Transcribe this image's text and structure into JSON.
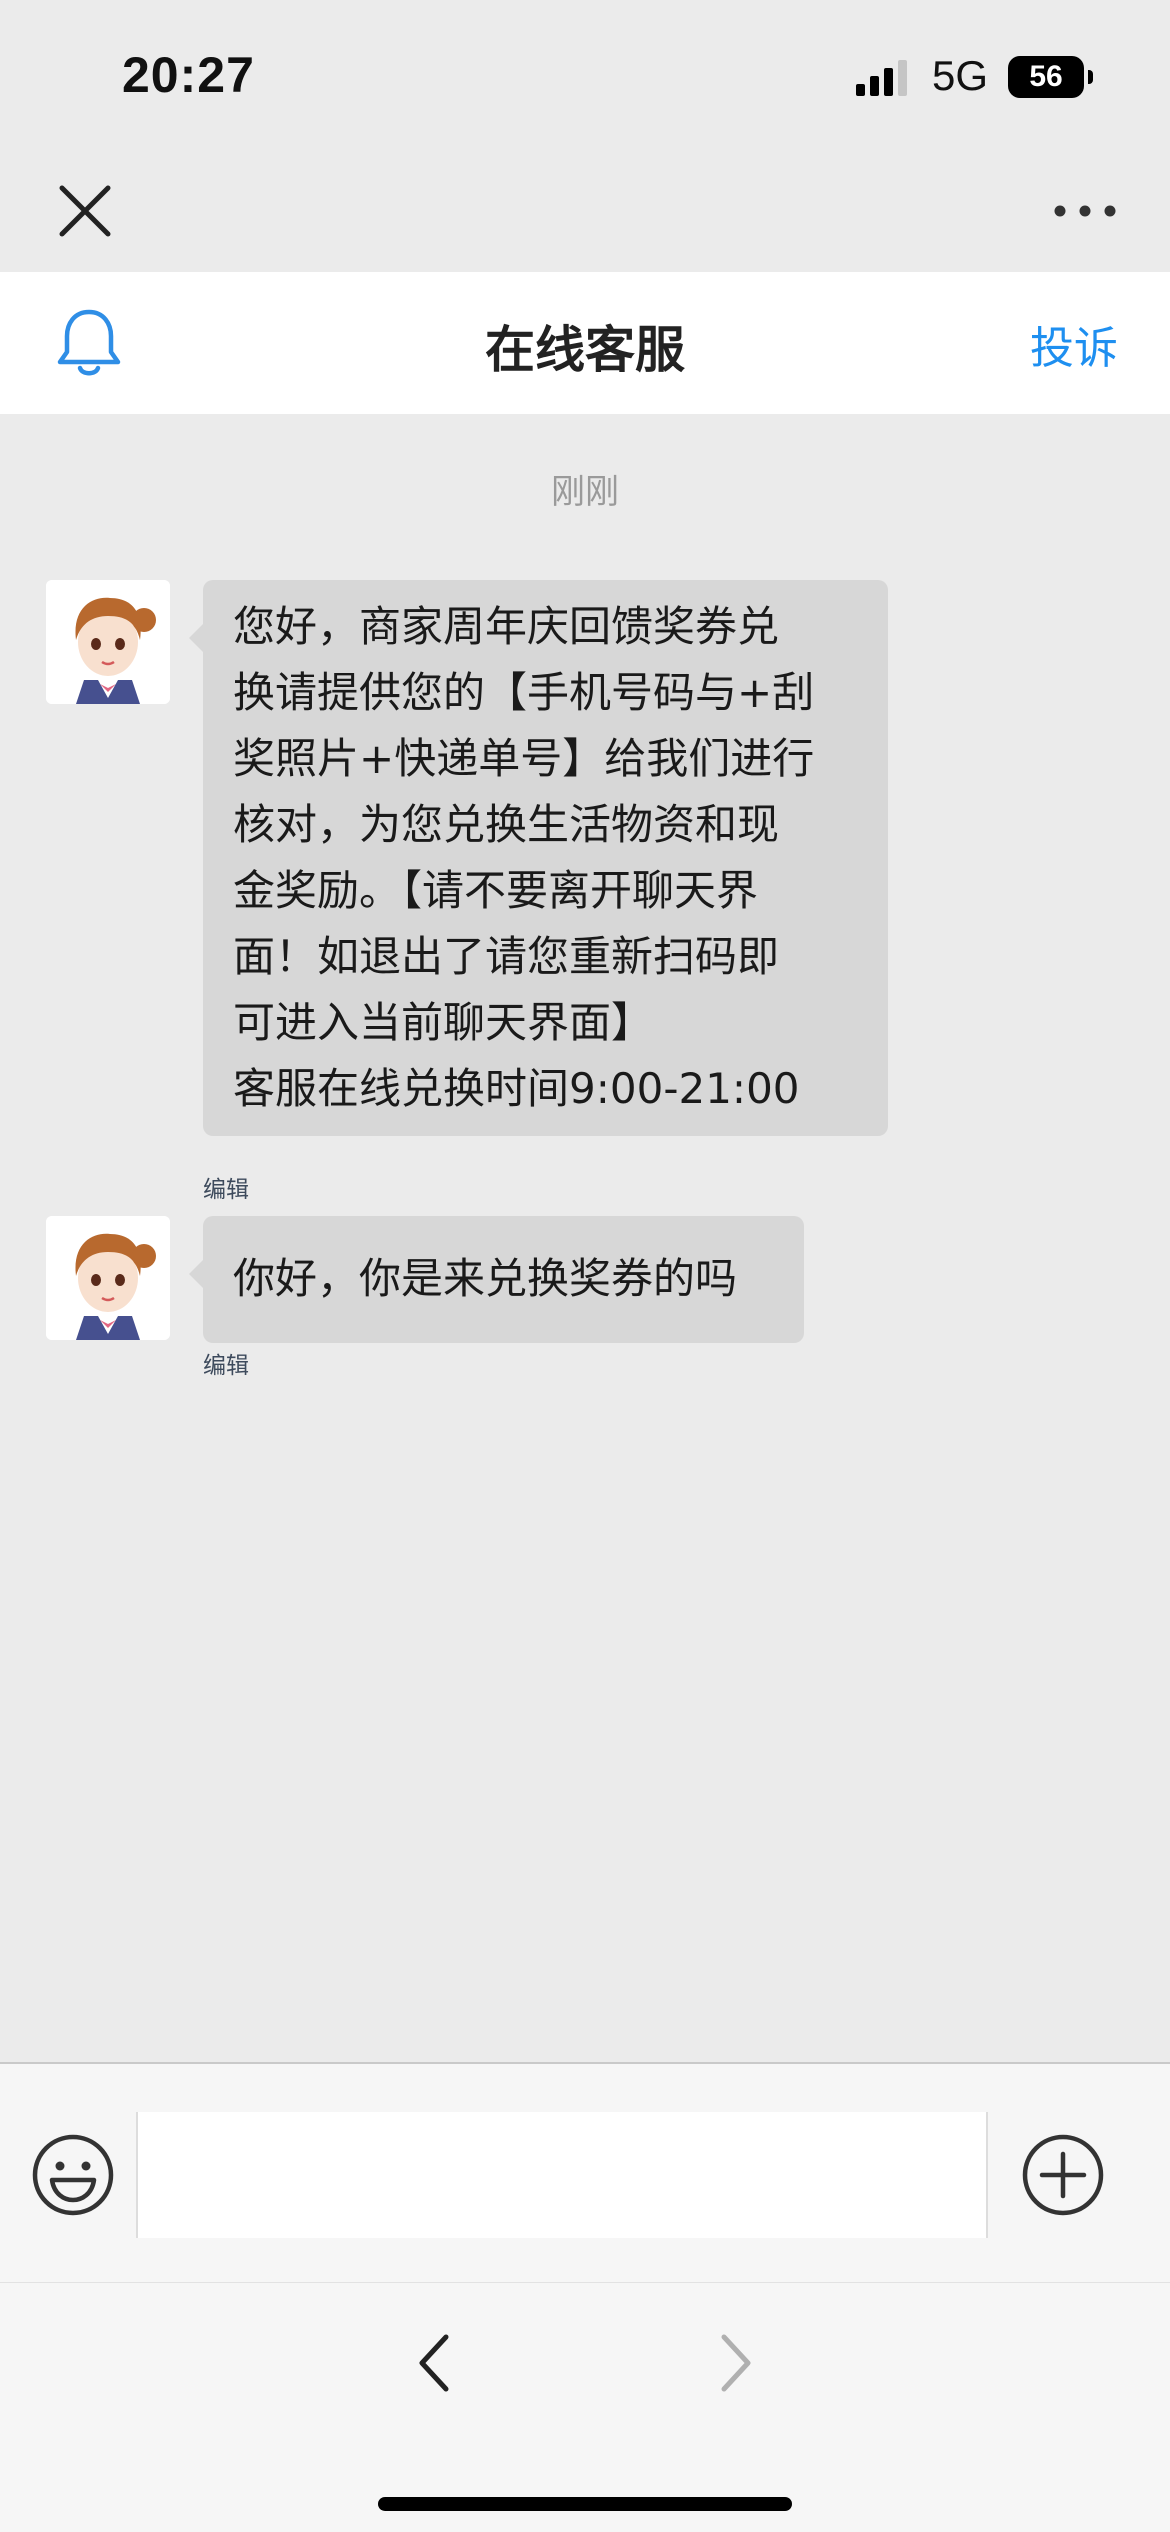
{
  "status_bar": {
    "time": "20:27",
    "network": "5G",
    "battery": "56"
  },
  "header": {
    "title": "在线客服",
    "complaint": "投诉"
  },
  "chat": {
    "timestamp": "刚刚",
    "messages": [
      {
        "lines": [
          "您好，商家周年庆回馈奖券兑",
          "换请提供您的【手机号码与+刮",
          "奖照片+快递单号】给我们进行",
          "核对，为您兑换生活物资和现",
          "金奖励。【请不要离开聊天界",
          "面！如退出了请您重新扫码即",
          "可进入当前聊天界面】",
          "客服在线兑换时间9:00-21:00"
        ],
        "edit_label": "编辑"
      },
      {
        "lines": [
          "你好，你是来兑换奖券的吗"
        ],
        "edit_label": "编辑"
      }
    ]
  },
  "input": {
    "value": "",
    "placeholder": ""
  },
  "icons": {
    "close": "close-icon",
    "more": "more-icon",
    "bell": "bell-icon",
    "emoji": "emoji-icon",
    "plus": "plus-icon",
    "back": "back-icon",
    "forward": "forward-icon"
  },
  "colors": {
    "accent": "#1e8ff0",
    "bubble": "#d7d7d7",
    "background": "#ebebeb"
  }
}
